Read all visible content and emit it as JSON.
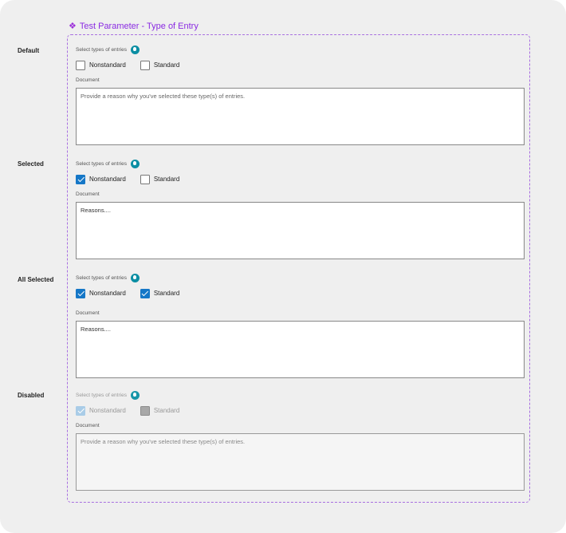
{
  "component": {
    "title": "Test Parameter - Type of Entry",
    "title_icon": "component-diamond-icon",
    "accent_color": "#8a2be2"
  },
  "states": [
    {
      "label": "Default",
      "field_label": "Select types of entries",
      "options": [
        {
          "label": "Nonstandard",
          "checked": false
        },
        {
          "label": "Standard",
          "checked": false
        }
      ],
      "document_label": "Document",
      "document_text": "Provide a reason why you've selected these type(s) of entries."
    },
    {
      "label": "Selected",
      "field_label": "Select types of entries",
      "options": [
        {
          "label": "Nonstandard",
          "checked": true
        },
        {
          "label": "Standard",
          "checked": false
        }
      ],
      "document_label": "Document",
      "document_text": "Reasons...."
    },
    {
      "label": "All Selected",
      "field_label": "Select types of entries",
      "options": [
        {
          "label": "Nonstandard",
          "checked": true
        },
        {
          "label": "Standard",
          "checked": true
        }
      ],
      "document_label": "Document",
      "document_text": "Reasons...."
    },
    {
      "label": "Disabled",
      "field_label": "Select types of entries",
      "options": [
        {
          "label": "Nonstandard",
          "checked": true
        },
        {
          "label": "Standard",
          "checked": false
        }
      ],
      "document_label": "Document",
      "document_text": "Provide a reason why you've selected these type(s) of entries."
    }
  ],
  "colors": {
    "checkbox_checked": "#1577c7",
    "help_icon": "#0b8ea3",
    "frame_border": "#a86fe0"
  }
}
